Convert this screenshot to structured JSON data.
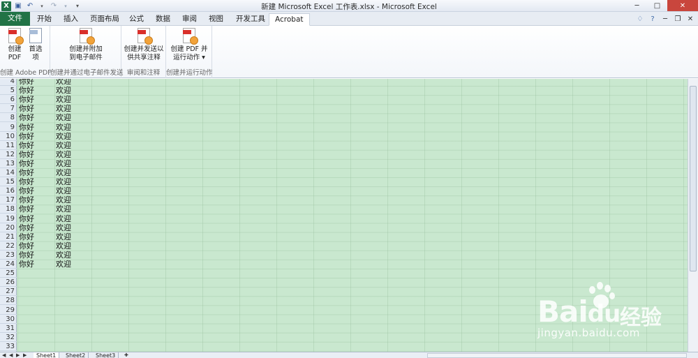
{
  "window": {
    "title": "新建 Microsoft Excel 工作表.xlsx - Microsoft Excel"
  },
  "tabs": [
    {
      "label": "文件"
    },
    {
      "label": "开始"
    },
    {
      "label": "插入"
    },
    {
      "label": "页面布局"
    },
    {
      "label": "公式"
    },
    {
      "label": "数据"
    },
    {
      "label": "审阅"
    },
    {
      "label": "视图"
    },
    {
      "label": "开发工具"
    },
    {
      "label": "Acrobat"
    }
  ],
  "ribbon": {
    "groups": [
      {
        "label": "创建 Adobe PDF",
        "buttons": [
          {
            "line1": "创建",
            "line2": "PDF"
          },
          {
            "line1": "首选",
            "line2": "项"
          }
        ]
      },
      {
        "label": "创建并通过电子邮件发送",
        "buttons": [
          {
            "line1": "创建并附加",
            "line2": "到电子邮件"
          }
        ]
      },
      {
        "label": "审阅和注释",
        "buttons": [
          {
            "line1": "创建并发送以",
            "line2": "供共享注释"
          }
        ]
      },
      {
        "label": "创建并运行动作",
        "buttons": [
          {
            "line1": "创建 PDF 并",
            "line2": "运行动作 ▾"
          }
        ]
      }
    ]
  },
  "sheet": {
    "rows": [
      {
        "num": "4",
        "a": "你好",
        "b": "欢迎"
      },
      {
        "num": "5",
        "a": "你好",
        "b": "欢迎"
      },
      {
        "num": "6",
        "a": "你好",
        "b": "欢迎"
      },
      {
        "num": "7",
        "a": "你好",
        "b": "欢迎"
      },
      {
        "num": "8",
        "a": "你好",
        "b": "欢迎"
      },
      {
        "num": "9",
        "a": "你好",
        "b": "欢迎"
      },
      {
        "num": "10",
        "a": "你好",
        "b": "欢迎"
      },
      {
        "num": "11",
        "a": "你好",
        "b": "欢迎"
      },
      {
        "num": "12",
        "a": "你好",
        "b": "欢迎"
      },
      {
        "num": "13",
        "a": "你好",
        "b": "欢迎"
      },
      {
        "num": "14",
        "a": "你好",
        "b": "欢迎"
      },
      {
        "num": "15",
        "a": "你好",
        "b": "欢迎"
      },
      {
        "num": "16",
        "a": "你好",
        "b": "欢迎"
      },
      {
        "num": "17",
        "a": "你好",
        "b": "欢迎"
      },
      {
        "num": "18",
        "a": "你好",
        "b": "欢迎"
      },
      {
        "num": "19",
        "a": "你好",
        "b": "欢迎"
      },
      {
        "num": "20",
        "a": "你好",
        "b": "欢迎"
      },
      {
        "num": "21",
        "a": "你好",
        "b": "欢迎"
      },
      {
        "num": "22",
        "a": "你好",
        "b": "欢迎"
      },
      {
        "num": "23",
        "a": "你好",
        "b": "欢迎"
      },
      {
        "num": "24",
        "a": "你好",
        "b": "欢迎"
      },
      {
        "num": "25",
        "a": "",
        "b": ""
      },
      {
        "num": "26",
        "a": "",
        "b": ""
      },
      {
        "num": "27",
        "a": "",
        "b": ""
      },
      {
        "num": "28",
        "a": "",
        "b": ""
      },
      {
        "num": "29",
        "a": "",
        "b": ""
      },
      {
        "num": "30",
        "a": "",
        "b": ""
      },
      {
        "num": "31",
        "a": "",
        "b": ""
      },
      {
        "num": "32",
        "a": "",
        "b": ""
      },
      {
        "num": "33",
        "a": "",
        "b": ""
      }
    ],
    "sheet_tabs": [
      {
        "label": "Sheet1"
      },
      {
        "label": "Sheet2"
      },
      {
        "label": "Sheet3"
      }
    ]
  },
  "watermark": {
    "brand": "Bai",
    "brand_tail": "du",
    "cn": "经验",
    "url": "jingyan.baidu.com"
  }
}
